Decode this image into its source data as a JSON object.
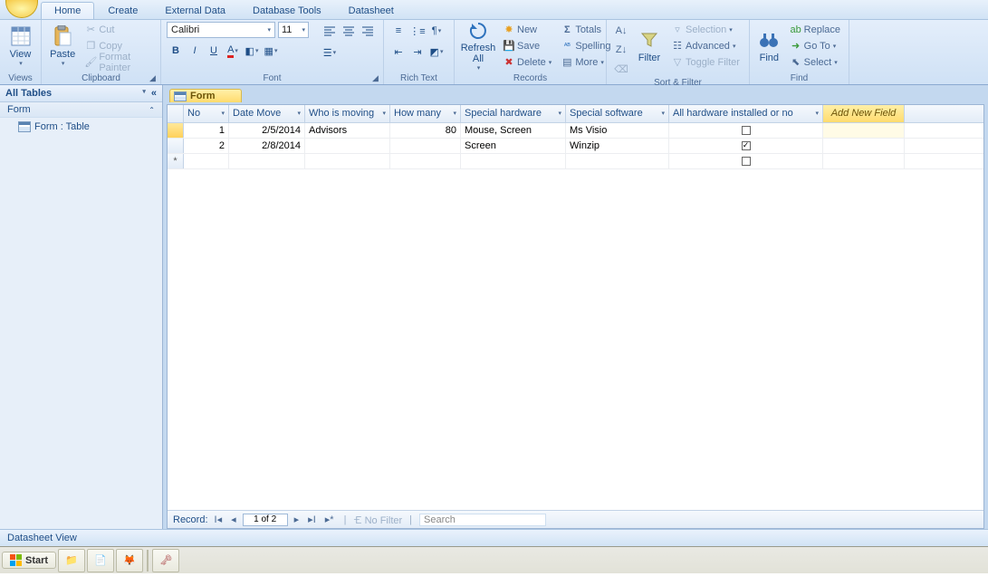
{
  "tabs": {
    "home": "Home",
    "create": "Create",
    "external": "External Data",
    "dbtools": "Database Tools",
    "datasheet": "Datasheet"
  },
  "ribbon": {
    "views": {
      "label": "Views",
      "view": "View"
    },
    "clipboard": {
      "label": "Clipboard",
      "paste": "Paste",
      "cut": "Cut",
      "copy": "Copy",
      "fp": "Format Painter"
    },
    "font": {
      "label": "Font",
      "name": "Calibri",
      "size": "11"
    },
    "richtext": {
      "label": "Rich Text"
    },
    "records": {
      "label": "Records",
      "refresh": "Refresh\nAll",
      "new": "New",
      "save": "Save",
      "delete": "Delete",
      "totals": "Totals",
      "spelling": "Spelling",
      "more": "More"
    },
    "sortfilter": {
      "label": "Sort & Filter",
      "filter": "Filter",
      "selection": "Selection",
      "advanced": "Advanced",
      "toggle": "Toggle Filter"
    },
    "find": {
      "label": "Find",
      "find": "Find",
      "replace": "Replace",
      "goto": "Go To",
      "select": "Select"
    }
  },
  "nav": {
    "header": "All Tables",
    "group": "Form",
    "item": "Form : Table"
  },
  "tab_title": "Form",
  "columns": [
    "No",
    "Date Move",
    "Who is moving",
    "How many",
    "Special hardware",
    "Special software",
    "All hardware installed or no"
  ],
  "addfield": "Add New Field",
  "rows": [
    {
      "no": "1",
      "dm": "2/5/2014",
      "who": "Advisors",
      "hm": "80",
      "hw": "Mouse, Screen",
      "sw": "Ms Visio",
      "inst": false
    },
    {
      "no": "2",
      "dm": "2/8/2014",
      "who": "",
      "hm": "",
      "hw": "Screen",
      "sw": "Winzip",
      "inst": true
    }
  ],
  "recbar": {
    "label": "Record:",
    "pos": "1 of 2",
    "nofilter": "No Filter",
    "search": "Search"
  },
  "status": "Datasheet View",
  "start": "Start"
}
